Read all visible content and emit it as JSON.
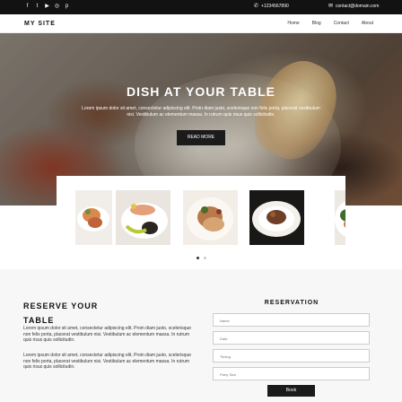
{
  "topbar": {
    "social_icons": [
      "facebook-icon",
      "twitter-icon",
      "youtube-icon",
      "instagram-icon",
      "pinterest-icon"
    ],
    "social_glyphs": [
      "f",
      "t",
      "▶",
      "◎",
      "p"
    ],
    "phone": "+1234567890",
    "email": "contact@domain.com"
  },
  "navbar": {
    "logo": "MY SITE",
    "links": [
      "Home",
      "Blog",
      "Contact",
      "About"
    ]
  },
  "hero": {
    "title": "DISH AT YOUR TABLE",
    "text": "Lorem ipsum dolor sit amet, consectetur adipiscing elit. Proin diam justo, scelerisque non felis porta, placerat vestibulum nisi. Vestibulum ac elementum massa. In rutrum quis risus quis sollicitudin.",
    "button": "READ MORE"
  },
  "gallery": {
    "items": [
      "dish-1",
      "dish-2",
      "dish-3",
      "dish-4",
      "dish-5"
    ],
    "active_dot": 0,
    "dot_count": 2
  },
  "reservation": {
    "heading_line1": "RESERVE YOUR",
    "heading_line2": "TABLE",
    "para1": "Lorem ipsum dolor sit amet, consectetur adipiscing elit. Proin diam justo, scelerisque non felis porta, placerat vestibulum nisi. Vestibulum ac elementum massa. In rutrum quis risus quis sollicitudin.",
    "para2": "Lorem ipsum dolor sit amet, consectetur adipiscing elit. Proin diam justo, scelerisque non felis porta, placerat vestibulum nisi. Vestibulum ac elementum massa. In rutrum quis risus quis sollicitudin.",
    "form_title": "RESERVATION",
    "fields": {
      "name": "Name",
      "date": "Date",
      "timing": "Timing",
      "party_size": "Party Size"
    },
    "submit": "Book"
  },
  "colors": {
    "topbar": "#121212",
    "button": "#1b1b1b",
    "section_bg": "#f7f7f7"
  }
}
